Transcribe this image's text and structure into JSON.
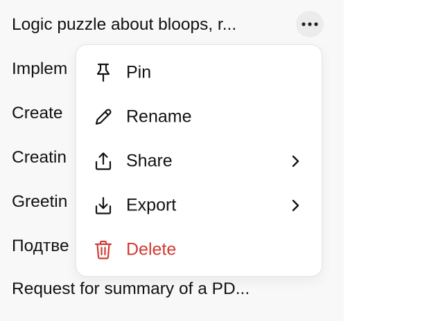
{
  "conversations": [
    {
      "title": "Logic puzzle about bloops, r..."
    },
    {
      "title": "Implem"
    },
    {
      "title": "Create"
    },
    {
      "title": "Creatin"
    },
    {
      "title": "Greetin"
    },
    {
      "title": "Подтве"
    },
    {
      "title": "Request for summary of a PD..."
    }
  ],
  "more_button": {
    "icon": "ellipsis-icon"
  },
  "context_menu": {
    "items": [
      {
        "label": "Pin",
        "icon": "pin-icon"
      },
      {
        "label": "Rename",
        "icon": "pencil-icon"
      },
      {
        "label": "Share",
        "icon": "share-icon",
        "submenu": true
      },
      {
        "label": "Export",
        "icon": "download-icon",
        "submenu": true
      },
      {
        "label": "Delete",
        "icon": "trash-icon",
        "danger": true
      }
    ]
  },
  "colors": {
    "sidebar_bg": "#f8f8f8",
    "danger": "#d03a32",
    "text": "#111111",
    "hover": "#ececec"
  }
}
